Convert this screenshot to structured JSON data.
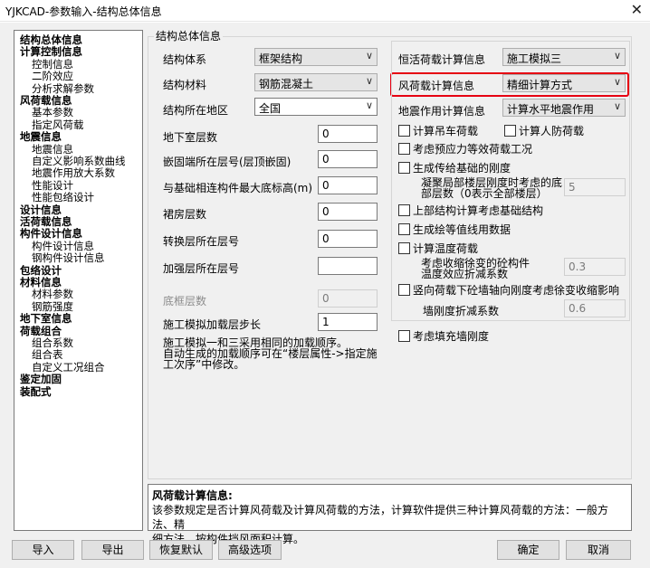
{
  "window": {
    "title": "YJKCAD-参数输入-结构总体信息",
    "close_glyph": "✕"
  },
  "tree": [
    {
      "label": "结构总体信息",
      "level": 0
    },
    {
      "label": "计算控制信息",
      "level": 0
    },
    {
      "label": "控制信息",
      "level": 1
    },
    {
      "label": "二阶效应",
      "level": 1
    },
    {
      "label": "分析求解参数",
      "level": 1
    },
    {
      "label": "风荷载信息",
      "level": 0
    },
    {
      "label": "基本参数",
      "level": 1
    },
    {
      "label": "指定风荷载",
      "level": 1
    },
    {
      "label": "地震信息",
      "level": 0
    },
    {
      "label": "地震信息",
      "level": 1
    },
    {
      "label": "自定义影响系数曲线",
      "level": 1
    },
    {
      "label": "地震作用放大系数",
      "level": 1
    },
    {
      "label": "性能设计",
      "level": 1
    },
    {
      "label": "性能包络设计",
      "level": 1
    },
    {
      "label": "设计信息",
      "level": 0
    },
    {
      "label": "活荷载信息",
      "level": 0
    },
    {
      "label": "构件设计信息",
      "level": 0
    },
    {
      "label": "构件设计信息",
      "level": 1
    },
    {
      "label": "钢构件设计信息",
      "level": 1
    },
    {
      "label": "包络设计",
      "level": 0
    },
    {
      "label": "材料信息",
      "level": 0
    },
    {
      "label": "材料参数",
      "level": 1
    },
    {
      "label": "钢筋强度",
      "level": 1
    },
    {
      "label": "地下室信息",
      "level": 0
    },
    {
      "label": "荷载组合",
      "level": 0
    },
    {
      "label": "组合系数",
      "level": 1
    },
    {
      "label": "组合表",
      "level": 1
    },
    {
      "label": "自定义工况组合",
      "level": 1
    },
    {
      "label": "鉴定加固",
      "level": 0
    },
    {
      "label": "装配式",
      "level": 0
    }
  ],
  "group": {
    "title": "结构总体信息"
  },
  "left": {
    "structure_system": {
      "label": "结构体系",
      "value": "框架结构"
    },
    "structure_material": {
      "label": "结构材料",
      "value": "钢筋混凝土"
    },
    "region": {
      "label": "结构所在地区",
      "value": "全国"
    },
    "basement_floors": {
      "label": "地下室层数",
      "value": "0"
    },
    "embed_floor": {
      "label": "嵌固端所在层号(层顶嵌固)",
      "value": "0"
    },
    "max_bottom_height": {
      "label": "与基础相连构件最大底标高(m)",
      "value": "0"
    },
    "podium_floors": {
      "label": "裙房层数",
      "value": "0"
    },
    "transfer_floor": {
      "label": "转换层所在层号",
      "value": "0"
    },
    "strengthen_floor": {
      "label": "加强层所在层号",
      "value": ""
    },
    "frame_floors": {
      "label": "底框层数",
      "value": "0"
    },
    "construction_step": {
      "label": "施工模拟加载层步长",
      "value": "1"
    },
    "note_lines": [
      "施工模拟一和三采用相同的加载顺序。",
      "自动生成的加载顺序可在“楼层属性->指定施",
      "工次序”中修改。"
    ]
  },
  "right": {
    "dead_live": {
      "label": "恒活荷载计算信息",
      "value": "施工模拟三"
    },
    "wind": {
      "label": "风荷载计算信息",
      "value": "精细计算方式"
    },
    "seismic": {
      "label": "地震作用计算信息",
      "value": "计算水平地震作用"
    },
    "crane": {
      "label": "计算吊车荷载",
      "checked": false
    },
    "civil_defense": {
      "label": "计算人防荷载",
      "checked": false
    },
    "prestress": {
      "label": "考虑预应力等效荷载工况",
      "checked": false
    },
    "foundation_stiffness": {
      "label": "生成传给基础的刚度",
      "checked": false
    },
    "condensation_label": [
      "凝聚局部楼层刚度时考虑的底",
      "部层数（0表示全部楼层）"
    ],
    "condensation_value": "5",
    "upper_foundation": {
      "label": "上部结构计算考虑基础结构",
      "checked": false
    },
    "contour_data": {
      "label": "生成绘等值线用数据",
      "checked": false
    },
    "temperature": {
      "label": "计算温度荷载",
      "checked": false
    },
    "shrinkage_label": [
      "考虑收缩徐变的砼构件",
      "温度效应折减系数"
    ],
    "shrinkage_value": "0.3",
    "vertical_shrink": {
      "label": "竖向荷载下砼墙轴向刚度考虑徐变收缩影响",
      "checked": false
    },
    "wall_reduction_label": "墙刚度折减系数",
    "wall_reduction_value": "0.6",
    "infill_wall": {
      "label": "考虑填充墙刚度",
      "checked": false
    }
  },
  "description": {
    "title": "风荷载计算信息:",
    "lines": [
      "该参数规定是否计算风荷载及计算风荷载的方法，计算软件提供三种计算风荷载的方法：一般方法、精",
      "细方法、按构件挡风面积计算。"
    ]
  },
  "buttons": {
    "import": "导入",
    "export": "导出",
    "reset": "恢复默认",
    "advanced": "高级选项",
    "ok": "确定",
    "cancel": "取消"
  },
  "colors": {
    "highlight": "#e60012",
    "background": "#f0f0f0"
  }
}
